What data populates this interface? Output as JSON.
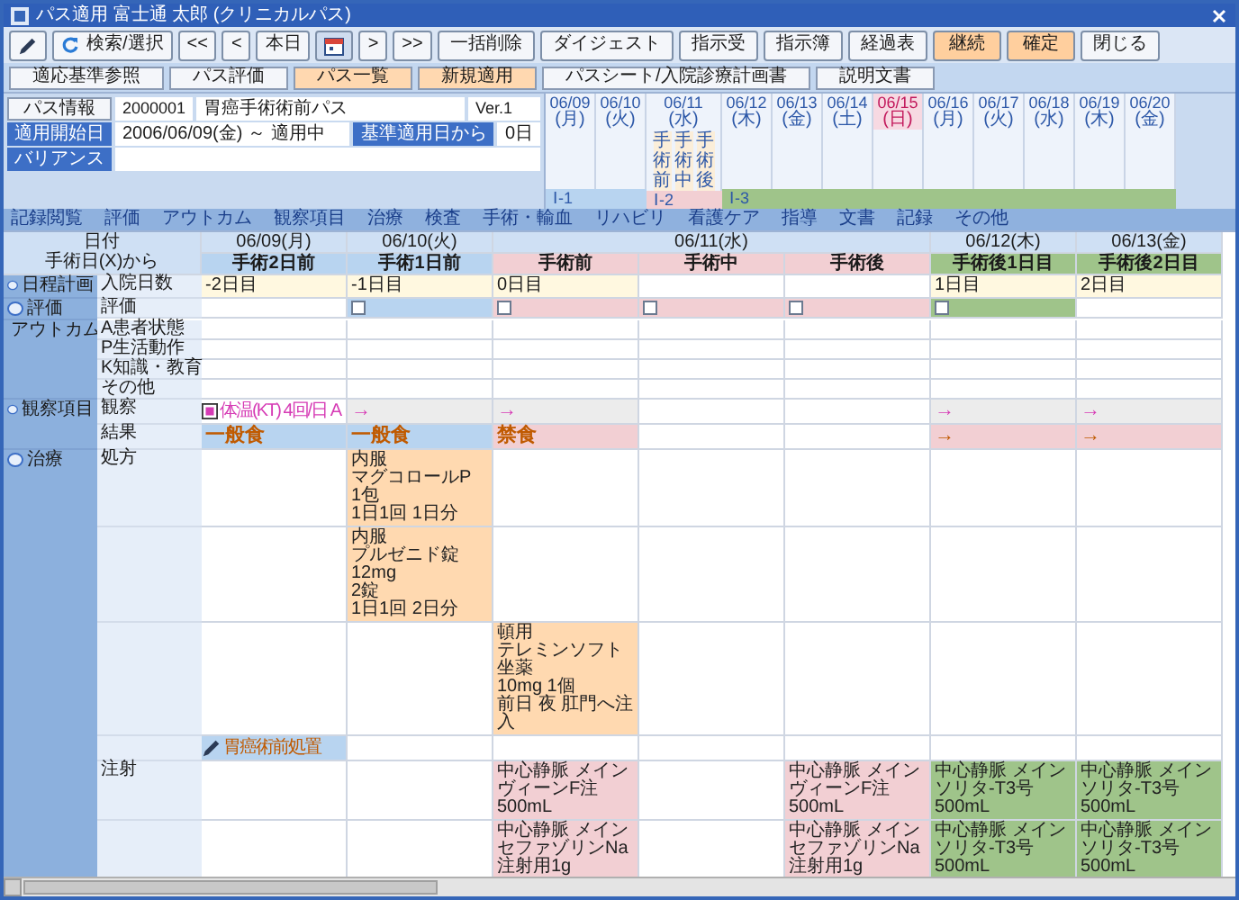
{
  "window": {
    "title": "パス適用 富士通 太郎 (クリニカルパス)"
  },
  "toolbar": [
    {
      "kind": "edit"
    },
    {
      "kind": "search",
      "label": "検索/選択"
    },
    {
      "kind": "nav",
      "label": "<<"
    },
    {
      "kind": "nav",
      "label": "<"
    },
    {
      "kind": "nav",
      "label": "本日"
    },
    {
      "kind": "calendar"
    },
    {
      "kind": "nav",
      "label": ">"
    },
    {
      "kind": "nav",
      "label": ">>"
    },
    {
      "kind": "normal",
      "label": "一括削除"
    },
    {
      "kind": "normal",
      "label": "ダイジェスト"
    },
    {
      "kind": "normal",
      "label": "指示受"
    },
    {
      "kind": "normal",
      "label": "指示簿"
    },
    {
      "kind": "normal",
      "label": "経過表"
    },
    {
      "kind": "accent",
      "label": "継続"
    },
    {
      "kind": "accent",
      "label": "確定"
    },
    {
      "kind": "normal",
      "label": "閉じる"
    }
  ],
  "subtoolbar": [
    {
      "label": "適応基準参照",
      "selected": false
    },
    {
      "label": "パス評価",
      "selected": false
    },
    {
      "label": "パス一覧",
      "selected": true
    },
    {
      "label": "新規適用",
      "selected": true
    },
    {
      "label": "パスシート/入院診療計画書",
      "selected": false
    },
    {
      "label": "説明文書",
      "selected": false
    }
  ],
  "pass_info": {
    "button": "パス情報",
    "code": "2000001",
    "name": "胃癌手術術前パス",
    "version": "Ver.1",
    "start_label": "適用開始日",
    "start_value": "2006/06/09(金) ～ 適用中",
    "base_label": "基準適用日から",
    "base_value": "0日",
    "variance_label": "バリアンス"
  },
  "phases": [
    {
      "label": "Ⅰ-1",
      "color": "#b8d4f0",
      "days": [
        {
          "date": "06/09",
          "weekday": "(月)",
          "holiday": false
        },
        {
          "date": "06/10",
          "weekday": "(火)",
          "holiday": false
        }
      ]
    },
    {
      "label": "Ⅰ-2",
      "color": "#f2cfd3",
      "days": [
        {
          "date": "06/11",
          "weekday": "(水)",
          "holiday": false,
          "stages": [
            "手術前",
            "手術中",
            "手術後"
          ]
        }
      ]
    },
    {
      "label": "Ⅰ-3",
      "color": "#9fc48a",
      "days": [
        {
          "date": "06/12",
          "weekday": "(木)",
          "holiday": false
        },
        {
          "date": "06/13",
          "weekday": "(金)",
          "holiday": false
        },
        {
          "date": "06/14",
          "weekday": "(土)",
          "holiday": false
        },
        {
          "date": "06/15",
          "weekday": "(日)",
          "holiday": true
        },
        {
          "date": "06/16",
          "weekday": "(月)",
          "holiday": false
        },
        {
          "date": "06/17",
          "weekday": "(火)",
          "holiday": false
        },
        {
          "date": "06/18",
          "weekday": "(水)",
          "holiday": false
        },
        {
          "date": "06/19",
          "weekday": "(木)",
          "holiday": false
        },
        {
          "date": "06/20",
          "weekday": "(金)",
          "holiday": false
        }
      ]
    }
  ],
  "categories": [
    "記録閲覧",
    "評価",
    "アウトカム",
    "観察項目",
    "治療",
    "検査",
    "手術・輸血",
    "リハビリ",
    "看護ケア",
    "指導",
    "文書",
    "記録",
    "その他"
  ],
  "grid": {
    "date_label": "日付",
    "relative_label": "手術日(X)から",
    "dates": [
      {
        "label": "06/09(月)",
        "columns": [
          {
            "label": "手術2日前",
            "color": "#b8d4f0"
          }
        ]
      },
      {
        "label": "06/10(火)",
        "columns": [
          {
            "label": "手術1日前",
            "color": "#b8d4f0"
          }
        ]
      },
      {
        "label": "06/11(水)",
        "columns": [
          {
            "label": "手術前",
            "color": "#f2cfd3"
          },
          {
            "label": "手術中",
            "color": "#f2cfd3"
          },
          {
            "label": "手術後",
            "color": "#f2cfd3"
          }
        ]
      },
      {
        "label": "06/12(木)",
        "columns": [
          {
            "label": "手術後1日目",
            "color": "#9fc48a"
          }
        ]
      },
      {
        "label": "06/13(金)",
        "columns": [
          {
            "label": "手術後2日目",
            "color": "#9fc48a"
          }
        ]
      }
    ],
    "groups": [
      {
        "label": "日程計画",
        "rows": [
          {
            "label": "入院日数",
            "cells": [
              {
                "kind": "text",
                "text": "-2日目",
                "color": "#fff8e0"
              },
              {
                "kind": "text",
                "text": "-1日目",
                "color": "#fff8e0"
              },
              {
                "kind": "text",
                "text": "0日目",
                "color": "#fff8e0"
              },
              {
                "kind": "empty",
                "color": "#ffffff"
              },
              {
                "kind": "empty",
                "color": "#ffffff"
              },
              {
                "kind": "text",
                "text": "1日目",
                "color": "#fff8e0"
              },
              {
                "kind": "text",
                "text": "2日目",
                "color": "#fff8e0"
              }
            ]
          }
        ]
      },
      {
        "label": "評価",
        "rows": [
          {
            "label": "評価",
            "cells": [
              {
                "kind": "empty",
                "color": "#ffffff"
              },
              {
                "kind": "check",
                "color": "#b8d4f0"
              },
              {
                "kind": "check",
                "color": "#f2cfd3"
              },
              {
                "kind": "check",
                "color": "#f2cfd3"
              },
              {
                "kind": "check",
                "color": "#f2cfd3"
              },
              {
                "kind": "check",
                "color": "#9fc48a"
              },
              {
                "kind": "empty",
                "color": "#ffffff"
              }
            ]
          }
        ]
      },
      {
        "label": "アウトカム",
        "rows": [
          {
            "label": "A患者状態",
            "cells": []
          },
          {
            "label": "P生活動作",
            "cells": []
          },
          {
            "label": "K知識・教育",
            "cells": []
          },
          {
            "label": "その他",
            "cells": []
          }
        ]
      },
      {
        "label": "観察項目",
        "rows": [
          {
            "label": "観察",
            "cells": [
              {
                "kind": "note",
                "icon": true,
                "label": {
                  "text": "体温(KT) 4回/日 A",
                  "color": "#d63bb5"
                },
                "color": "#ffffff"
              },
              {
                "kind": "text",
                "label": {
                  "text": "→",
                  "color": "#d63bb5"
                },
                "color": "#ececec"
              },
              {
                "kind": "text",
                "label": {
                  "text": "→",
                  "color": "#d63bb5"
                },
                "color": "#ececec"
              },
              {
                "kind": "empty",
                "color": "#ffffff"
              },
              {
                "kind": "empty",
                "color": "#ffffff"
              },
              {
                "kind": "text",
                "label": {
                  "text": "→",
                  "color": "#d63bb5"
                },
                "color": "#ececec"
              },
              {
                "kind": "text",
                "label": {
                  "text": "→",
                  "color": "#d63bb5"
                },
                "color": "#ececec"
              }
            ]
          },
          {
            "label": "結果",
            "cells": [
              {
                "kind": "text",
                "label": {
                  "text": "一般食",
                  "color": "#c05a00"
                },
                "color": "#b8d4f0"
              },
              {
                "kind": "text",
                "label": {
                  "text": "一般食",
                  "color": "#c05a00"
                },
                "color": "#b8d4f0"
              },
              {
                "kind": "text",
                "label": {
                  "text": "禁食",
                  "color": "#c05a00"
                },
                "color": "#f2cfd3"
              },
              {
                "kind": "empty",
                "color": "#ffffff"
              },
              {
                "kind": "empty",
                "color": "#ffffff"
              },
              {
                "kind": "text",
                "label": {
                  "text": "→",
                  "color": "#c05a00"
                },
                "color": "#f2cfd3"
              },
              {
                "kind": "text",
                "label": {
                  "text": "→",
                  "color": "#c05a00"
                },
                "color": "#f2cfd3"
              }
            ]
          }
        ]
      },
      {
        "label": "治療",
        "rows": [
          {
            "label": "処方",
            "cells": [
              {
                "kind": "empty",
                "color": "#ffffff"
              },
              {
                "kind": "order",
                "lines": [
                  "内服",
                  "マグコロールP",
                  "1包",
                  "1日1回 1日分"
                ],
                "color": "#ffd9b0"
              }
            ]
          },
          {
            "cells": [
              {
                "kind": "empty",
                "color": "#ffffff"
              },
              {
                "kind": "order",
                "lines": [
                  "内服",
                  "プルゼニド錠12mg",
                  "2錠",
                  "1日1回 2日分"
                ],
                "color": "#ffd9b0"
              }
            ]
          },
          {
            "cells": [
              {
                "kind": "empty",
                "color": "#ffffff"
              },
              {
                "kind": "empty",
                "color": "#ffffff"
              },
              {
                "kind": "order",
                "lines": [
                  "頓用",
                  "テレミンソフト坐薬",
                  "10mg 1個",
                  "前日 夜 肛門へ注入"
                ],
                "color": "#ffd9b0"
              }
            ]
          },
          {
            "cells": [
              {
                "kind": "note",
                "pencil": true,
                "label": {
                  "text": "胃癌術前処置",
                  "color": "#c05a00"
                },
                "color": "#b8d4f0"
              }
            ]
          },
          {
            "label": "注射",
            "cells": [
              {
                "kind": "empty",
                "color": "#ffffff"
              },
              {
                "kind": "empty",
                "color": "#ffffff"
              },
              {
                "kind": "order",
                "lines": [
                  "中心静脈 メイン",
                  "ヴィーンF注500mL"
                ],
                "color": "#f2cfd3"
              },
              {
                "kind": "empty",
                "color": "#ffffff"
              },
              {
                "kind": "order",
                "lines": [
                  "中心静脈 メイン",
                  "ヴィーンF注500mL"
                ],
                "color": "#f2cfd3"
              },
              {
                "kind": "order",
                "lines": [
                  "中心静脈 メイン",
                  "ソリタ-T3号500mL"
                ],
                "color": "#9fc48a"
              },
              {
                "kind": "order",
                "lines": [
                  "中心静脈 メイン",
                  "ソリタ-T3号500mL"
                ],
                "color": "#9fc48a"
              }
            ]
          },
          {
            "cells": [
              {
                "kind": "empty",
                "color": "#ffffff"
              },
              {
                "kind": "empty",
                "color": "#ffffff"
              },
              {
                "kind": "order",
                "lines": [
                  "中心静脈 メイン",
                  "セファゾリンNa注射用1g"
                ],
                "color": "#f2cfd3"
              },
              {
                "kind": "empty",
                "color": "#ffffff"
              },
              {
                "kind": "order",
                "lines": [
                  "中心静脈 メイン",
                  "セファゾリンNa注射用1g"
                ],
                "color": "#f2cfd3"
              },
              {
                "kind": "order",
                "lines": [
                  "中心静脈 メイン",
                  "ソリタ-T3号500mL"
                ],
                "color": "#9fc48a"
              },
              {
                "kind": "order",
                "lines": [
                  "中心静脈 メイン",
                  "ソリタ-T3号500mL"
                ],
                "color": "#9fc48a"
              }
            ]
          }
        ]
      }
    ]
  }
}
